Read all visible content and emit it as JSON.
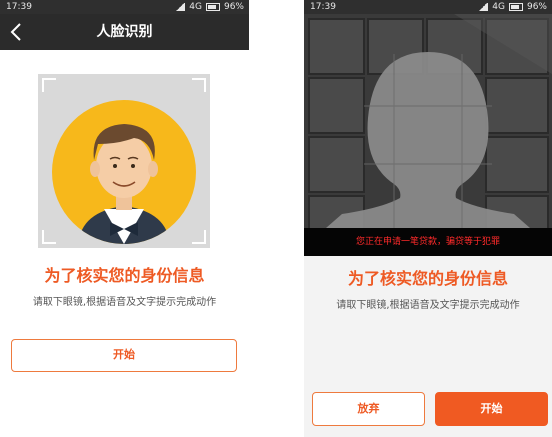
{
  "left_screen": {
    "status": {
      "time": "17:39",
      "icons": [
        "alarm-icon",
        "vibrate-icon",
        "signal-icon",
        "4g-icon",
        "battery-icon"
      ],
      "network": "4G",
      "battery": "96%"
    },
    "nav": {
      "title": "人脸识别",
      "back_icon": "chevron-left-icon"
    },
    "headline": "为了核实您的身份信息",
    "instruction": "请取下眼镜,根据语音及文字提示完成动作",
    "start_button": "开始"
  },
  "right_screen": {
    "status": {
      "time": "17:39",
      "network": "4G",
      "battery": "96%"
    },
    "warning": "您正在申请一笔贷款，骗贷等于犯罪",
    "headline": "为了核实您的身份信息",
    "instruction": "请取下眼镜,根据语音及文字提示完成动作",
    "abandon_button": "放弃",
    "start_button": "开始"
  },
  "colors": {
    "accent": "#f05a22",
    "navbar": "#2b2b2b",
    "avatar_bg": "#f7b81b",
    "warning": "#ff2a2a"
  }
}
